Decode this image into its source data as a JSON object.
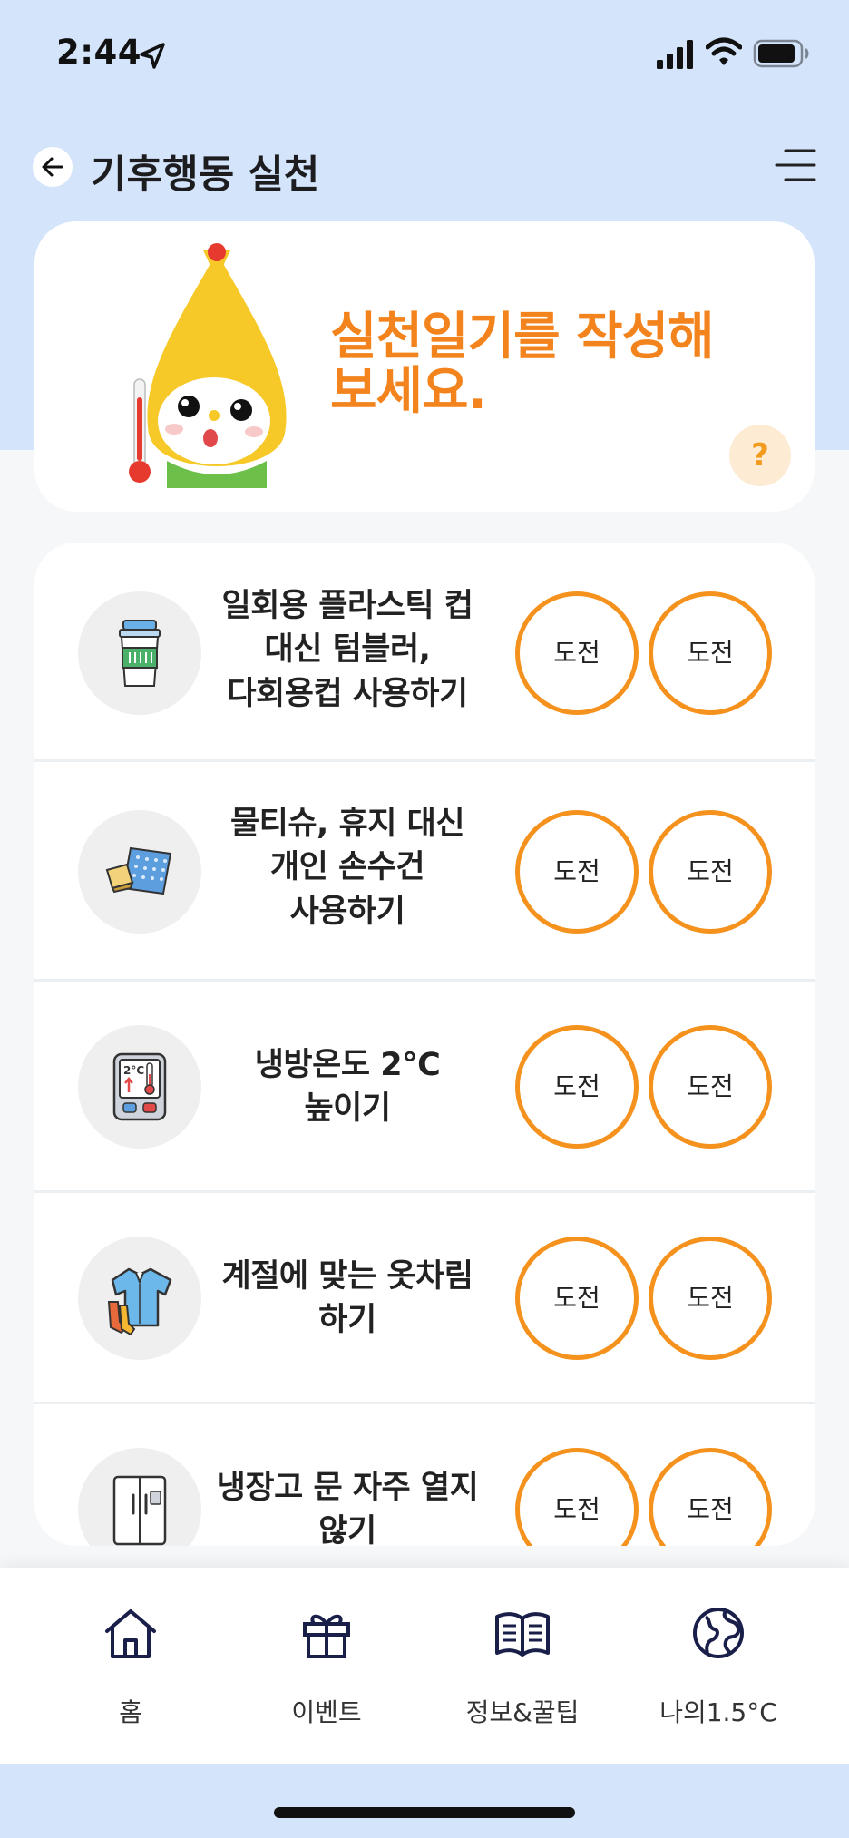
{
  "status_bar": {
    "time": "2:44"
  },
  "header": {
    "title": "기후행동 실천"
  },
  "banner": {
    "line1": "실천일기를 작성해",
    "line2": "보세요.",
    "help_label": "?"
  },
  "actions": [
    {
      "icon": "tumbler-icon",
      "lines": [
        "일회용 플라스틱 컵",
        "대신 텀블러,",
        "다회용컵 사용하기"
      ],
      "button1": "도전",
      "button2": "도전"
    },
    {
      "icon": "handkerchief-icon",
      "lines": [
        "물티슈, 휴지 대신",
        "개인 손수건",
        "사용하기"
      ],
      "button1": "도전",
      "button2": "도전"
    },
    {
      "icon": "thermostat-icon",
      "lines": [
        "냉방온도 2°C",
        "높이기"
      ],
      "button1": "도전",
      "button2": "도전"
    },
    {
      "icon": "clothing-icon",
      "lines": [
        "계절에 맞는 옷차림",
        "하기"
      ],
      "button1": "도전",
      "button2": "도전"
    },
    {
      "icon": "refrigerator-icon",
      "lines": [
        "냉장고 문 자주 열지",
        "않기"
      ],
      "button1": "도전",
      "button2": "도전"
    }
  ],
  "bottom_nav": [
    {
      "label": "홈",
      "icon": "home-icon"
    },
    {
      "label": "이벤트",
      "icon": "gift-icon"
    },
    {
      "label": "정보&꿀팁",
      "icon": "book-icon"
    },
    {
      "label": "나의1.5°C",
      "icon": "globe-icon"
    }
  ]
}
